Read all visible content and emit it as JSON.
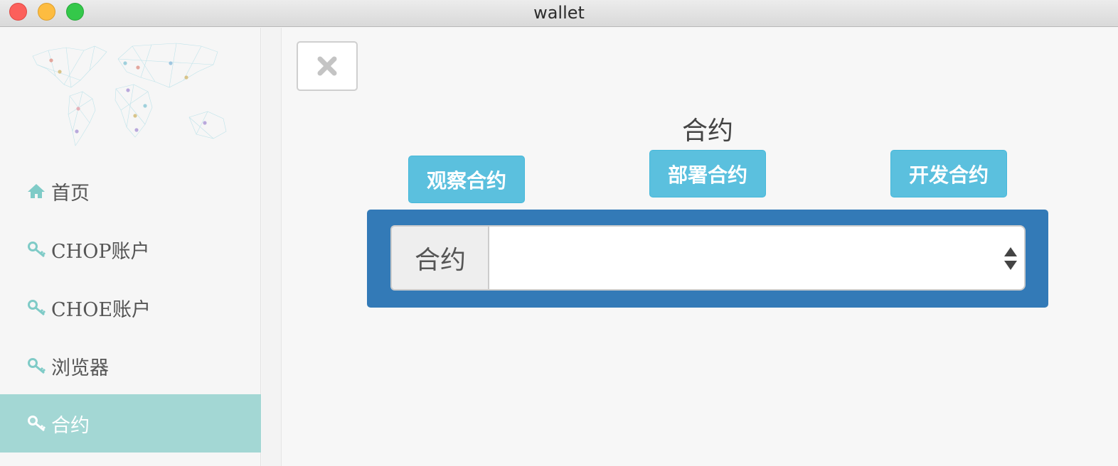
{
  "window": {
    "title": "wallet"
  },
  "sidebar": {
    "items": [
      {
        "label": "首页",
        "icon": "home-icon",
        "active": false
      },
      {
        "label": "CHOP账户",
        "icon": "key-icon",
        "active": false
      },
      {
        "label": "CHOE账户",
        "icon": "key-icon",
        "active": false
      },
      {
        "label": "浏览器",
        "icon": "key-icon",
        "active": false
      },
      {
        "label": "合约",
        "icon": "key-icon",
        "active": true
      }
    ]
  },
  "main": {
    "close_icon": "close-icon",
    "title": "合约",
    "buttons": {
      "observe": "观察合约",
      "deploy": "部署合约",
      "develop": "开发合约"
    },
    "form": {
      "addon_label": "合约",
      "select_value": ""
    }
  },
  "colors": {
    "accent_button": "#5bc0de",
    "panel": "#337ab7",
    "active_nav": "#a3d7d4",
    "icon_teal": "#7fcbc7"
  }
}
